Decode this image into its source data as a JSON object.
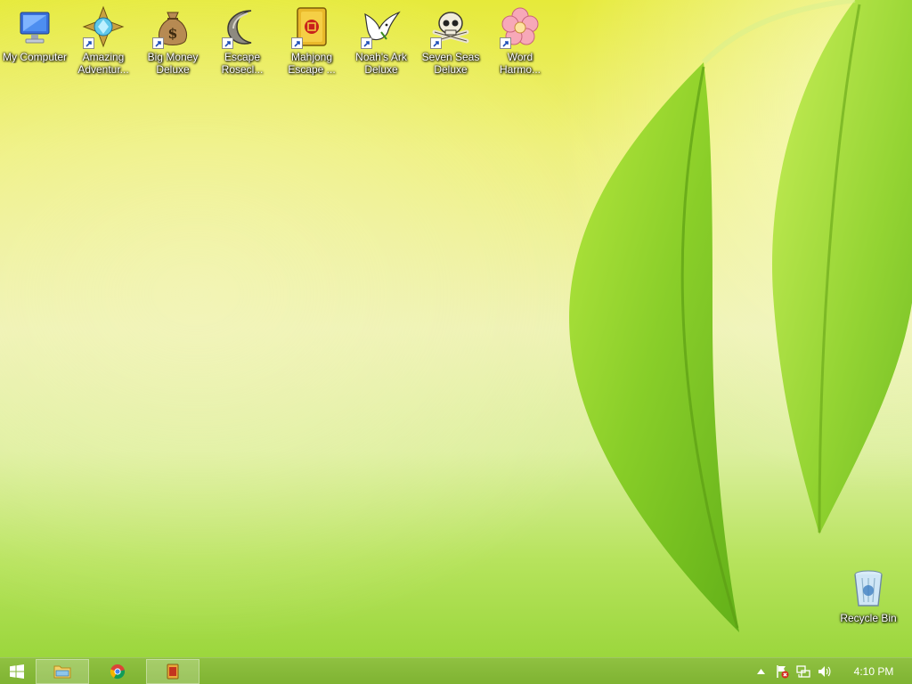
{
  "desktop": {
    "icons": [
      {
        "label": "My Computer",
        "icon": "computer-icon"
      },
      {
        "label": "Amazing\nAdventur...",
        "icon": "compass-gem-icon"
      },
      {
        "label": "Big Money\nDeluxe",
        "icon": "money-bag-icon"
      },
      {
        "label": "Escape\nRosecl...",
        "icon": "crescent-moon-icon"
      },
      {
        "label": "Mahjong\nEscape ...",
        "icon": "mahjong-tile-icon"
      },
      {
        "label": "Noah's Ark\nDeluxe",
        "icon": "dove-icon"
      },
      {
        "label": "Seven Seas\nDeluxe",
        "icon": "skull-crossbones-icon"
      },
      {
        "label": "Word\nHarmo...",
        "icon": "flower-icon"
      }
    ],
    "recycle_bin": {
      "label": "Recycle Bin",
      "icon": "recycle-bin-icon"
    }
  },
  "taskbar": {
    "start": {
      "icon": "windows-logo-icon"
    },
    "pinned": [
      {
        "name": "file-explorer",
        "icon": "folder-icon",
        "active": true
      },
      {
        "name": "chrome",
        "icon": "chrome-icon",
        "active": false
      },
      {
        "name": "game-app",
        "icon": "game-app-icon",
        "active": true
      }
    ],
    "tray": {
      "icons": [
        "show-hidden-icons-chevron",
        "action-center-flag-icon",
        "network-icon",
        "volume-icon"
      ],
      "time": "4:10 PM"
    }
  },
  "colors": {
    "taskbar": "#86ba38",
    "leaf": "#8ccf2e",
    "label_text": "#ffffff"
  }
}
